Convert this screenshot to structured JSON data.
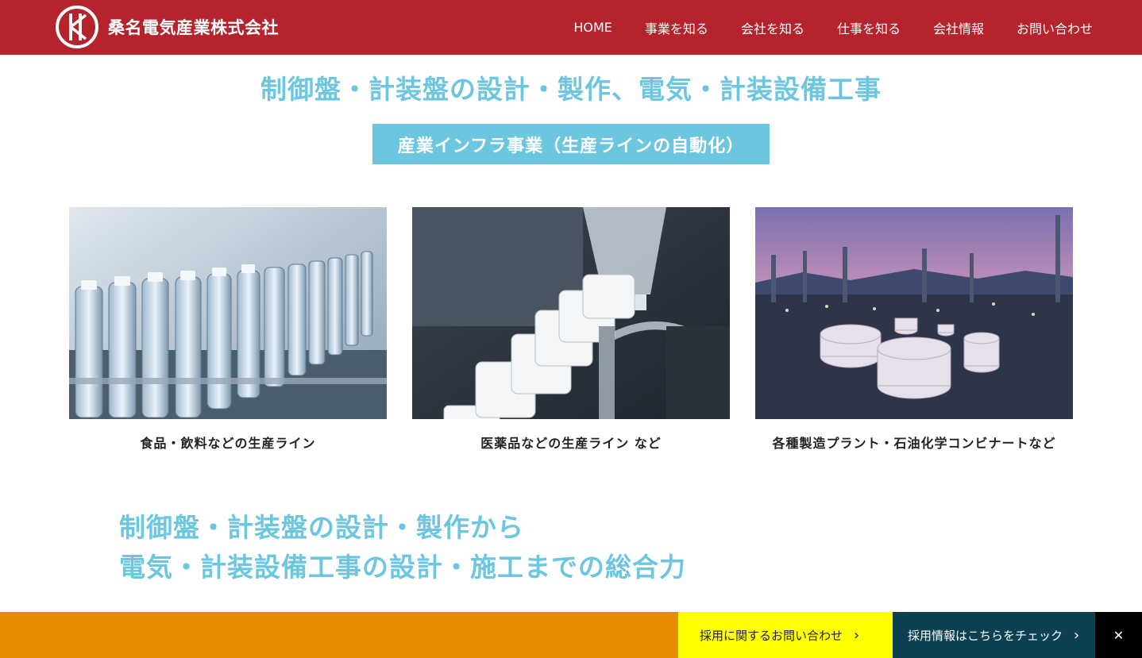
{
  "header": {
    "company_name": "桑名電気産業株式会社",
    "brand_color": "#b5232c",
    "nav": [
      {
        "label": "HOME"
      },
      {
        "label": "事業を知る"
      },
      {
        "label": "会社を知る"
      },
      {
        "label": "仕事を知る"
      },
      {
        "label": "会社情報"
      },
      {
        "label": "お問い合わせ"
      }
    ]
  },
  "main": {
    "heading": "制御盤・計装盤の設計・製作、電気・計装設備工事",
    "section_badge": "産業インフラ事業（生産ラインの自動化）",
    "accent_color": "#6cc6e0",
    "cards": [
      {
        "caption": "食品・飲料などの生産ライン",
        "image": "bottling-line-photo"
      },
      {
        "caption": "医薬品などの生産ライン など",
        "image": "pharma-bottle-line-photo"
      },
      {
        "caption": "各種製造プラント・石油化学コンビナートなど",
        "image": "petrochemical-plant-photo"
      }
    ],
    "tagline": {
      "line1": "制御盤・計装盤の設計・製作から",
      "line2": "電気・計装設備工事の設計・施工までの総合力"
    }
  },
  "footer_bar": {
    "contact_label": "採用に関するお問い合わせ",
    "recruit_label": "採用情報はこちらをチェック",
    "close_label": "✕",
    "bar_color": "#e68a00",
    "contact_color": "#ffff00",
    "recruit_color": "#0d4152"
  }
}
